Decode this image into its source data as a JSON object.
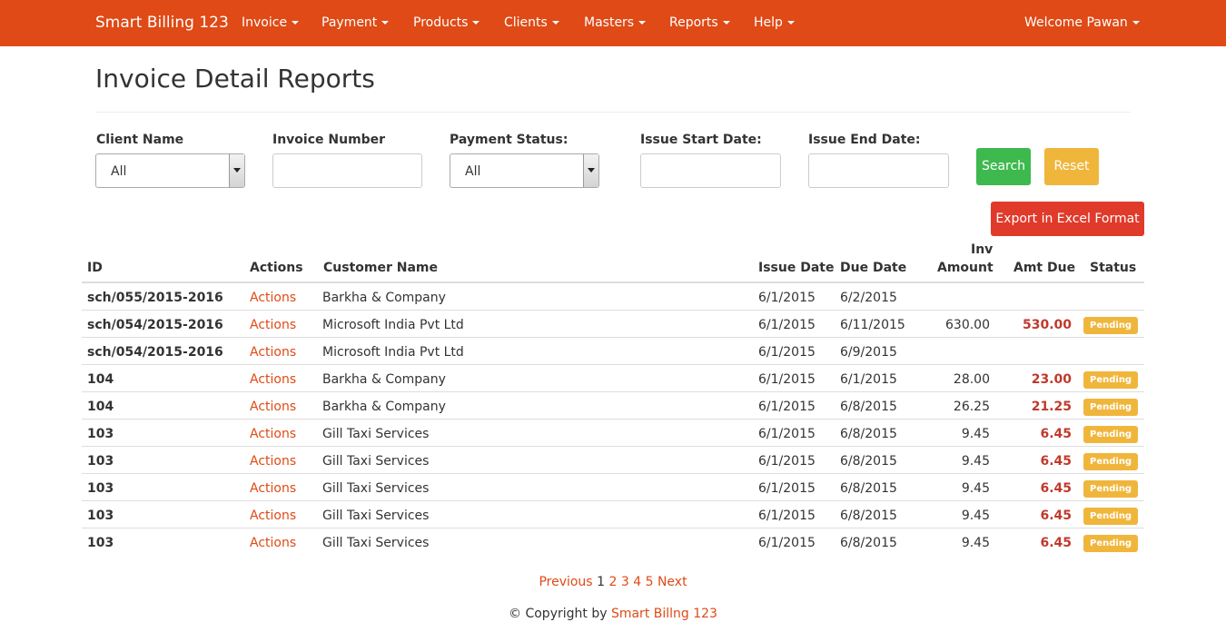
{
  "colors": {
    "navbar": "#df4a16",
    "accent": "#df4a16",
    "search": "#3db94e",
    "reset": "#f0b63c",
    "export": "#e03a2b",
    "amount_due": "#c0392b",
    "pending": "#f0b63c"
  },
  "navbar": {
    "brand": "Smart Billing 123",
    "items": [
      {
        "label": "Invoice"
      },
      {
        "label": "Payment"
      },
      {
        "label": "Products"
      },
      {
        "label": "Clients"
      },
      {
        "label": "Masters"
      },
      {
        "label": "Reports"
      },
      {
        "label": "Help"
      }
    ],
    "welcome": "Welcome Pawan"
  },
  "page": {
    "title": "Invoice Detail Reports"
  },
  "filters": {
    "client_name": {
      "label": "Client Name",
      "value": "All"
    },
    "invoice_number": {
      "label": "Invoice Number",
      "value": ""
    },
    "payment_status": {
      "label": "Payment Status:",
      "value": "All"
    },
    "issue_start_date": {
      "label": "Issue Start Date:",
      "value": ""
    },
    "issue_end_date": {
      "label": "Issue End Date:",
      "value": ""
    },
    "search_label": "Search",
    "reset_label": "Reset",
    "export_label": "Export in Excel Format"
  },
  "table": {
    "headers": {
      "id": "ID",
      "actions": "Actions",
      "customer": "Customer Name",
      "issue_date": "Issue Date",
      "due_date": "Due Date",
      "inv_amount_1": "Inv",
      "inv_amount_2": "Amount",
      "amt_due": "Amt Due",
      "status": "Status"
    },
    "rows": [
      {
        "id": "sch/055/2015-2016",
        "action": "Actions",
        "customer": "Barkha & Company",
        "issue": "6/1/2015",
        "due": "6/2/2015",
        "inv": "",
        "amt": "",
        "status": ""
      },
      {
        "id": "sch/054/2015-2016",
        "action": "Actions",
        "customer": "Microsoft India Pvt Ltd",
        "issue": "6/1/2015",
        "due": "6/11/2015",
        "inv": "630.00",
        "amt": "530.00",
        "status": "Pending"
      },
      {
        "id": "sch/054/2015-2016",
        "action": "Actions",
        "customer": "Microsoft India Pvt Ltd",
        "issue": "6/1/2015",
        "due": "6/9/2015",
        "inv": "",
        "amt": "",
        "status": ""
      },
      {
        "id": "104",
        "action": "Actions",
        "customer": "Barkha & Company",
        "issue": "6/1/2015",
        "due": "6/1/2015",
        "inv": "28.00",
        "amt": "23.00",
        "status": "Pending"
      },
      {
        "id": "104",
        "action": "Actions",
        "customer": "Barkha & Company",
        "issue": "6/1/2015",
        "due": "6/8/2015",
        "inv": "26.25",
        "amt": "21.25",
        "status": "Pending"
      },
      {
        "id": "103",
        "action": "Actions",
        "customer": "Gill Taxi Services",
        "issue": "6/1/2015",
        "due": "6/8/2015",
        "inv": "9.45",
        "amt": "6.45",
        "status": "Pending"
      },
      {
        "id": "103",
        "action": "Actions",
        "customer": "Gill Taxi Services",
        "issue": "6/1/2015",
        "due": "6/8/2015",
        "inv": "9.45",
        "amt": "6.45",
        "status": "Pending"
      },
      {
        "id": "103",
        "action": "Actions",
        "customer": "Gill Taxi Services",
        "issue": "6/1/2015",
        "due": "6/8/2015",
        "inv": "9.45",
        "amt": "6.45",
        "status": "Pending"
      },
      {
        "id": "103",
        "action": "Actions",
        "customer": "Gill Taxi Services",
        "issue": "6/1/2015",
        "due": "6/8/2015",
        "inv": "9.45",
        "amt": "6.45",
        "status": "Pending"
      },
      {
        "id": "103",
        "action": "Actions",
        "customer": "Gill Taxi Services",
        "issue": "6/1/2015",
        "due": "6/8/2015",
        "inv": "9.45",
        "amt": "6.45",
        "status": "Pending"
      }
    ]
  },
  "pagination": {
    "previous": "Previous",
    "pages": [
      "1",
      "2",
      "3",
      "4",
      "5"
    ],
    "current_page": "1",
    "next": "Next"
  },
  "footer": {
    "prefix": "© Copyright by",
    "brand": "Smart Billng 123"
  }
}
